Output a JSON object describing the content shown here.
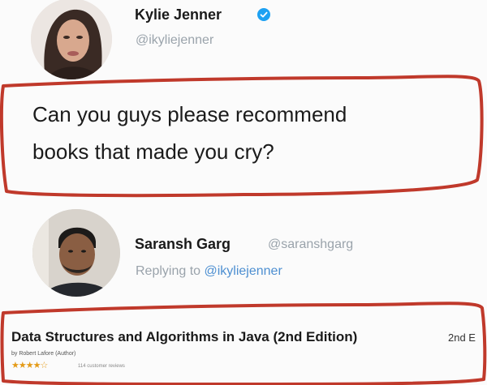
{
  "original_tweet": {
    "author_name": "Kylie Jenner",
    "author_handle": "@ikyliejenner",
    "verified": true,
    "text_line1": "Can you guys please recommend",
    "text_line2": "books that made you cry?"
  },
  "reply": {
    "author_name": "Saransh Garg",
    "author_handle": "@saranshgarg",
    "replying_prefix": "Replying to",
    "replying_to": "@ikyliejenner"
  },
  "book": {
    "title": "Data Structures and Algorithms in Java (2nd Edition)",
    "edition_tag": "2nd E",
    "author": "by Robert Lafore  (Author)",
    "stars": "★★★★☆",
    "reviews": "114 customer reviews"
  },
  "colors": {
    "annotation_red": "#c0392b",
    "link_blue": "#4d8fd1",
    "verified_blue": "#1da1f2"
  }
}
